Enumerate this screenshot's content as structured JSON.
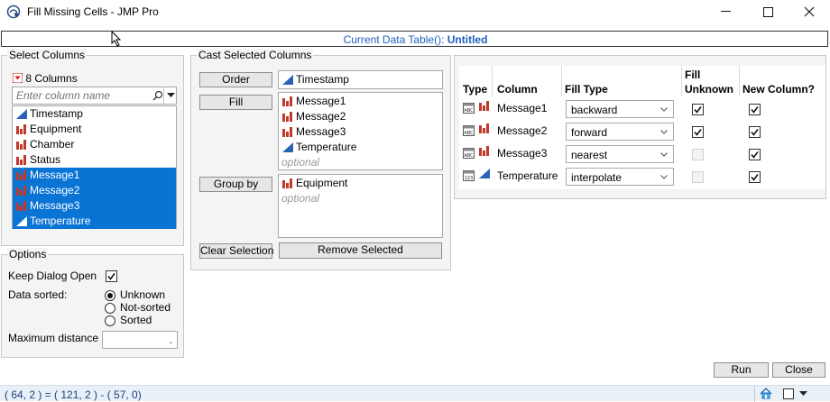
{
  "window": {
    "title": "Fill Missing Cells - JMP Pro",
    "controls": [
      "minimize",
      "maximize",
      "close"
    ]
  },
  "current_table": {
    "label": "Current Data Table():",
    "name": "Untitled"
  },
  "select_columns": {
    "title": "Select Columns",
    "count_label": "8 Columns",
    "search_placeholder": "Enter column name",
    "columns": [
      {
        "name": "Timestamp",
        "type": "continuous",
        "selected": false
      },
      {
        "name": "Equipment",
        "type": "nominal",
        "selected": false
      },
      {
        "name": "Chamber",
        "type": "nominal",
        "selected": false
      },
      {
        "name": "Status",
        "type": "nominal",
        "selected": false
      },
      {
        "name": "Message1",
        "type": "nominal",
        "selected": true
      },
      {
        "name": "Message2",
        "type": "nominal",
        "selected": true
      },
      {
        "name": "Message3",
        "type": "nominal",
        "selected": true
      },
      {
        "name": "Temperature",
        "type": "continuous",
        "selected": true
      }
    ]
  },
  "options": {
    "title": "Options",
    "keep_dialog_open_label": "Keep Dialog Open",
    "keep_dialog_open": true,
    "data_sorted_label": "Data sorted:",
    "sort_options": [
      "Unknown",
      "Not-sorted",
      "Sorted"
    ],
    "sort_selected": "Unknown",
    "max_distance_label": "Maximum distance",
    "max_distance_value": "."
  },
  "cast": {
    "title": "Cast Selected Columns",
    "order_label": "Order",
    "order_items": [
      {
        "name": "Timestamp",
        "type": "continuous"
      }
    ],
    "fill_label": "Fill",
    "fill_items": [
      {
        "name": "Message1",
        "type": "nominal"
      },
      {
        "name": "Message2",
        "type": "nominal"
      },
      {
        "name": "Message3",
        "type": "nominal"
      },
      {
        "name": "Temperature",
        "type": "continuous"
      }
    ],
    "fill_optional": "optional",
    "group_label": "Group by",
    "group_items": [
      {
        "name": "Equipment",
        "type": "nominal"
      }
    ],
    "group_optional": "optional",
    "clear_selection_label": "Clear Selection",
    "remove_selected_label": "Remove Selected"
  },
  "fill_table": {
    "headers": {
      "type": "Type",
      "column": "Column",
      "fill_type": "Fill Type",
      "fill_unknown_1": "Fill",
      "fill_unknown_2": "Unknown",
      "new_column": "New Column?"
    },
    "rows": [
      {
        "data_type": "character",
        "model": "nominal",
        "column": "Message1",
        "fill_type": "backward",
        "fill_unknown": true,
        "fill_unknown_enabled": true,
        "new_column": true
      },
      {
        "data_type": "character",
        "model": "nominal",
        "column": "Message2",
        "fill_type": "forward",
        "fill_unknown": true,
        "fill_unknown_enabled": true,
        "new_column": true
      },
      {
        "data_type": "character",
        "model": "nominal",
        "column": "Message3",
        "fill_type": "nearest",
        "fill_unknown": false,
        "fill_unknown_enabled": false,
        "new_column": true
      },
      {
        "data_type": "numeric",
        "model": "continuous",
        "column": "Temperature",
        "fill_type": "interpolate",
        "fill_unknown": false,
        "fill_unknown_enabled": false,
        "new_column": true
      }
    ],
    "type_badges": {
      "character": "ABC",
      "numeric": "123"
    }
  },
  "actions": {
    "run_label": "Run",
    "close_label": "Close"
  },
  "status": {
    "text": "( 64, 2 ) = ( 121, 2 ) - ( 57, 0)"
  },
  "colors": {
    "accent": "#0a74d4",
    "nominal": "#c0392b",
    "continuous": "#2a62b8",
    "link": "#1f5fbf"
  }
}
